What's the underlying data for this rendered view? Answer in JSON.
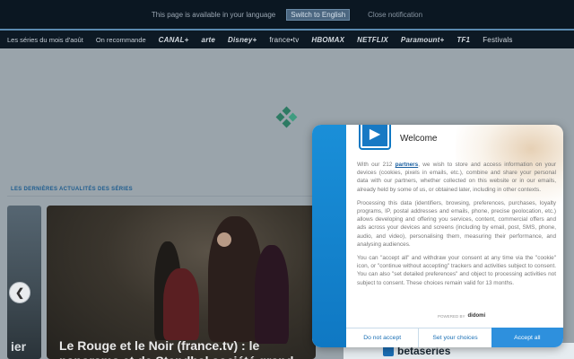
{
  "lang_bar": {
    "message": "This page is available in your language",
    "switch_label": "Switch to English",
    "close_label": "Close notification"
  },
  "nav": {
    "items": [
      "Les séries du mois d'août",
      "On recommande",
      "CANAL+",
      "arte",
      "Disney+",
      "france•tv",
      "HBOMAX",
      "NETFLIX",
      "Paramount+",
      "TF1",
      "Festivals"
    ]
  },
  "section": {
    "title": "LES DERNIÈRES ACTUALITÉS DES SÉRIES"
  },
  "cards": {
    "left_fragment": "ier",
    "main_title": "Le Rouge et le Noir (france.tv) : le panorama et de Stendhal société grand..."
  },
  "bottom_strip": {
    "logo": "betaseries"
  },
  "dialog": {
    "heading": "Welcome",
    "para1_pre": "With our 212 ",
    "para1_link": "partners",
    "para1_post": ", we wish to store and access information on your devices (cookies, pixels in emails, etc.), combine and share your personal data with our partners, whether collected on this website or in our emails, already held by some of us, or obtained later, including in other contexts.",
    "para2": "Processing this data (identifiers, browsing, preferences, purchases, loyalty programs, IP, postal addresses and emails, phone, precise geolocation, etc.) allows developing and offering you services, content, commercial offers and ads across your devices and screens (including by email, post, SMS, phone, audio, and video), personalising them, measuring their performance, and analysing audiences.",
    "para3": "You can \"accept all\" and withdraw your consent at any time via the \"cookie\" icon, or \"continue without accepting\" trackers and activities subject to consent. You can also \"set detailed preferences\" and object to processing activities not subject to consent. These choices remain valid for 13 months.",
    "powered_by": "POWERED BY",
    "powered_brand": "didomi",
    "btn_not_accept": "Do not accept",
    "btn_set_choices": "Set your choices",
    "btn_accept_all": "Accept all"
  },
  "colors": {
    "accent": "#1779c4",
    "accept_button": "#2e90dd",
    "overlay_bg": "#9aa4ab"
  }
}
